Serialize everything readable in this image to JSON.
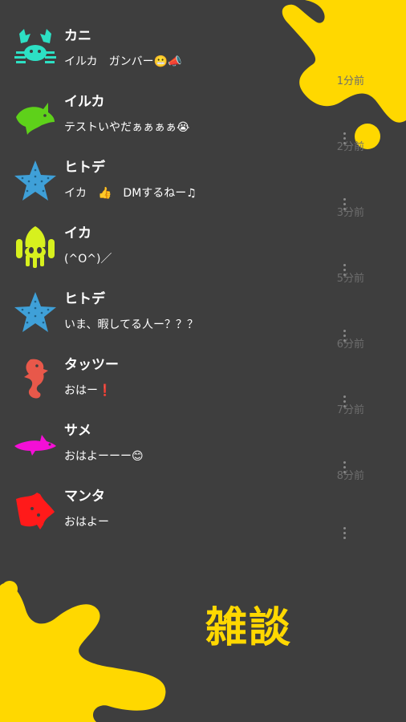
{
  "colors": {
    "background": "#3e3e3e",
    "splat_yellow": "#ffd800",
    "time_gray": "#6e6e6e"
  },
  "title": "雑談",
  "messages": [
    {
      "name": "カニ",
      "text": "イルカ　ガンバー😬📣",
      "time": "",
      "avatar": "crab-icon",
      "color": "#2de0c4"
    },
    {
      "name": "イルカ",
      "text": "テストいやだぁぁぁぁ😭",
      "time": "1分前",
      "avatar": "dolphin-icon",
      "color": "#5ed11a"
    },
    {
      "name": "ヒトデ",
      "text": "イカ　👍　DMするねー♫",
      "time": "2分前",
      "avatar": "starfish-icon",
      "color": "#3fa0d8"
    },
    {
      "name": "イカ",
      "text": "(^O^)／",
      "time": "3分前",
      "avatar": "squid-icon",
      "color": "#d7f01e"
    },
    {
      "name": "ヒトデ",
      "text": "いま、暇してる人ー？？？",
      "time": "5分前",
      "avatar": "starfish-icon",
      "color": "#3fa0d8"
    },
    {
      "name": "タッツー",
      "text": "おはー❗",
      "time": "6分前",
      "avatar": "seahorse-icon",
      "color": "#e8584a"
    },
    {
      "name": "サメ",
      "text": "おはよーーー😊",
      "time": "7分前",
      "avatar": "shark-icon",
      "color": "#f40fd6"
    },
    {
      "name": "マンタ",
      "text": "おはよー",
      "time": "8分前",
      "avatar": "manta-icon",
      "color": "#ff1a1a"
    }
  ]
}
